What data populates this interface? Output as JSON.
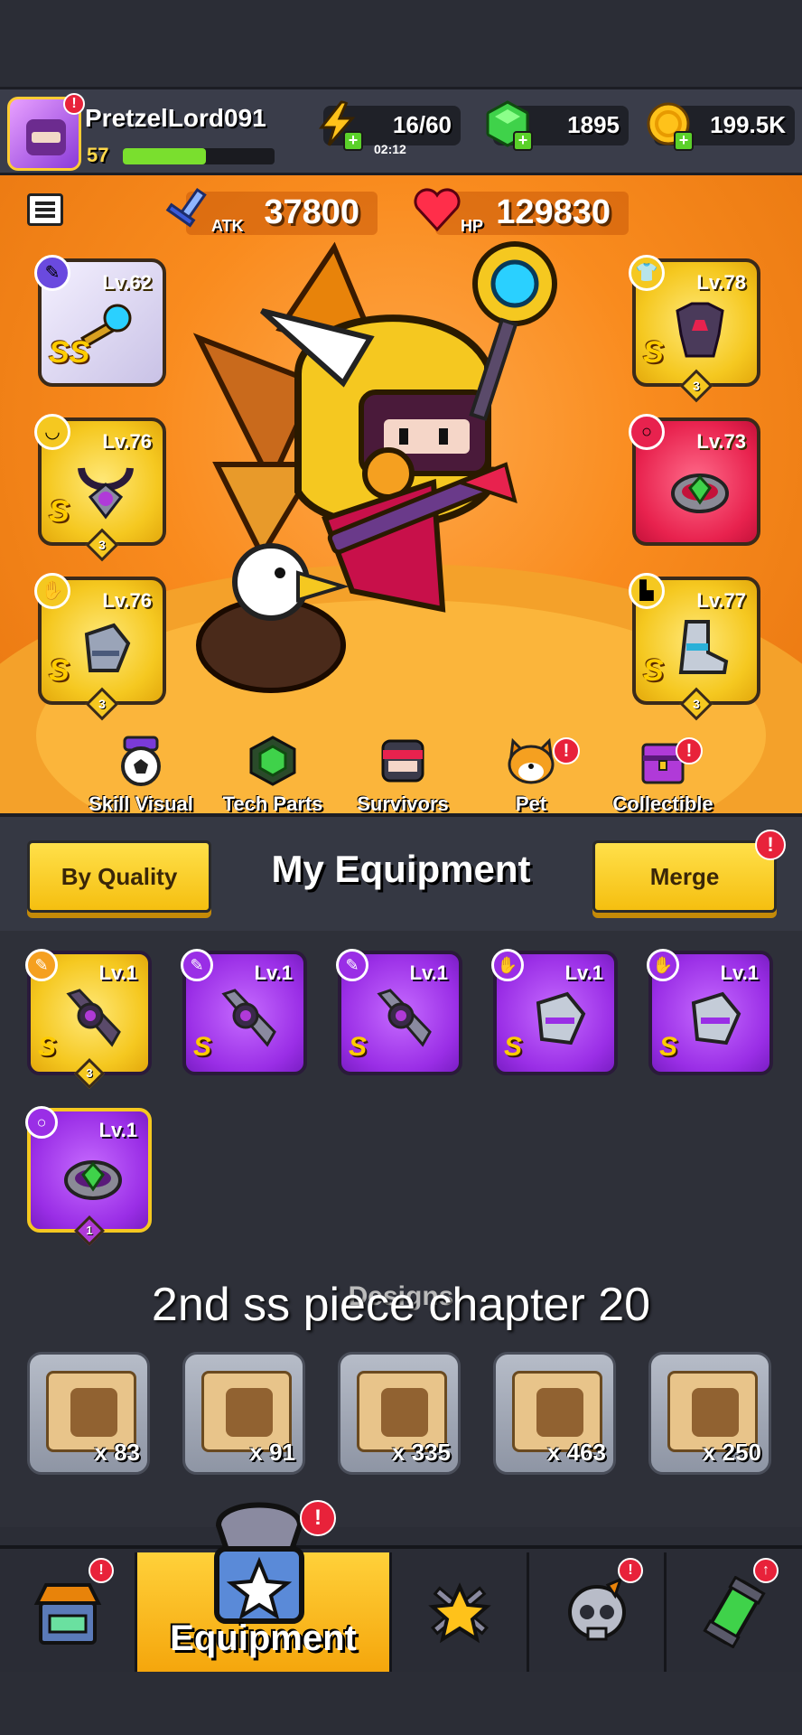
{
  "player": {
    "name": "PretzelLord091",
    "level": "57",
    "xp_fraction": 0.55
  },
  "resources": {
    "energy": "16/60",
    "energy_timer": "02:12",
    "gems": "1895",
    "coins": "199.5K"
  },
  "stats": {
    "atk_label": "ATK",
    "atk_value": "37800",
    "hp_label": "HP",
    "hp_value": "129830"
  },
  "equipped": {
    "weapon": {
      "level": "Lv.62",
      "grade": "SS"
    },
    "armor": {
      "level": "Lv.78",
      "grade": "S",
      "stars": "3"
    },
    "necklace": {
      "level": "Lv.76",
      "grade": "S",
      "stars": "3"
    },
    "ring": {
      "level": "Lv.73"
    },
    "gloves": {
      "level": "Lv.76",
      "grade": "S",
      "stars": "3"
    },
    "boots": {
      "level": "Lv.77",
      "grade": "S",
      "stars": "3"
    }
  },
  "subnav": [
    {
      "label": "Skill Visual",
      "icon": "soccer-ball-icon"
    },
    {
      "label": "Tech Parts",
      "icon": "hex-chip-icon"
    },
    {
      "label": "Survivors",
      "icon": "survivor-head-icon"
    },
    {
      "label": "Pet",
      "icon": "shiba-pet-icon"
    },
    {
      "label": "Collectible",
      "icon": "chest-icon"
    }
  ],
  "panel": {
    "sort_button": "By Quality",
    "title": "My Equipment",
    "merge_button": "Merge"
  },
  "inventory": [
    {
      "level": "Lv.1",
      "grade": "S",
      "stars": "3",
      "rarity": "gold",
      "type": "weapon"
    },
    {
      "level": "Lv.1",
      "grade": "S",
      "rarity": "purple",
      "type": "weapon"
    },
    {
      "level": "Lv.1",
      "grade": "S",
      "rarity": "purple",
      "type": "weapon"
    },
    {
      "level": "Lv.1",
      "grade": "S",
      "rarity": "purple",
      "type": "gloves"
    },
    {
      "level": "Lv.1",
      "grade": "S",
      "rarity": "purple",
      "type": "gloves"
    },
    {
      "level": "Lv.1",
      "stars": "1",
      "rarity": "purple",
      "type": "ring"
    }
  ],
  "overlay_caption": "2nd ss piece chapter 20",
  "designs_label": "Designs",
  "designs": [
    {
      "count": "x 83",
      "icon": "gun-design-icon"
    },
    {
      "count": "x 91",
      "icon": "shirt-design-icon"
    },
    {
      "count": "x 335",
      "icon": "necklace-design-icon"
    },
    {
      "count": "x 463",
      "icon": "ring-design-icon"
    },
    {
      "count": "x 250",
      "icon": "glove-design-icon"
    }
  ],
  "bottom_nav": {
    "active_label": "Equipment"
  },
  "colors": {
    "accent_yellow": "#f5c820",
    "alert_red": "#e8223a",
    "purple_rarity": "#9a2ee6",
    "hero_orange": "#f98b1e"
  }
}
